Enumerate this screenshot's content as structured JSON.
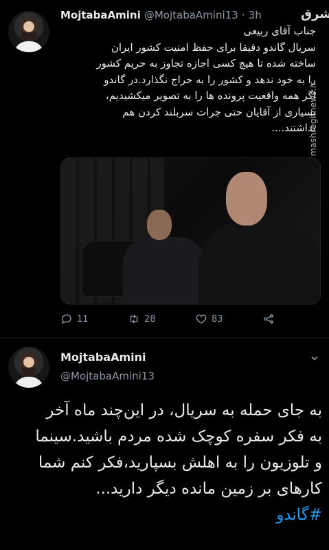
{
  "tweet1": {
    "display_name": "MojtabaAmini",
    "handle": "@MojtabaAmini13",
    "separator": "·",
    "time": "3h",
    "lines": [
      "جناب آقای ربیعی",
      "سریال گاندو دقیقا برای حفظ امنیت کشور ایران",
      "ساخته شده تا هیچ کسی اجازه تجاوز به حریم کشور",
      "را به خود ندهد و کشور را به حراج نگذارد.در گاندو",
      "اگر همه واقعیت پرونده ها را به تصویر میکشیدیم،",
      "بسیاری از آقایان حتی جرات سربلند کردن هم",
      "نداشتند...."
    ],
    "replies": "11",
    "retweets": "28",
    "likes": "83",
    "watermark_logo": "مشرق",
    "watermark_url": "mashreghnews.ir"
  },
  "tweet2": {
    "display_name": "MojtabaAmini",
    "handle": "@MojtabaAmini13",
    "lines": [
      "به جای حمله به سریال، در این‌چند ماه آخر",
      "به فکر سفره کوچک شده مردم باشید.سینما",
      "و تلوزیون را به اهلش بسپارید،فکر کنم شما",
      "کارهای بر زمین مانده دیگر دارید..."
    ],
    "hashtag": "#گاندو"
  },
  "icons": {
    "reply": "reply-icon",
    "retweet": "retweet-icon",
    "like": "heart-icon",
    "share": "share-icon",
    "more": "chevron-down-icon"
  },
  "colors": {
    "background": "#000000",
    "text": "#e7e9ea",
    "muted": "#8b98a5",
    "link": "#1d9bf0",
    "divider": "#2f3336"
  }
}
